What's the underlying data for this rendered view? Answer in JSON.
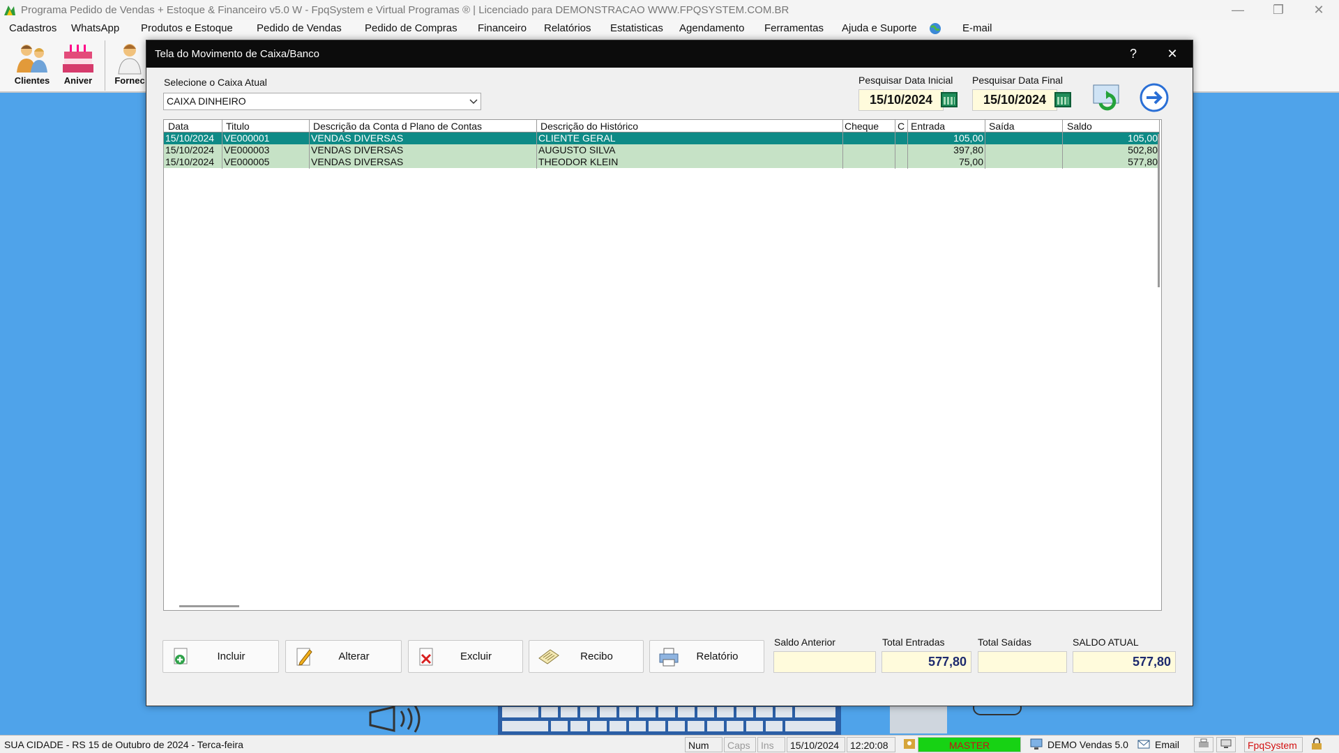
{
  "window": {
    "title": "Programa Pedido de Vendas + Estoque & Financeiro v5.0 W - FpqSystem e Virtual Programas ® | Licenciado para  DEMONSTRACAO WWW.FPQSYSTEM.COM.BR"
  },
  "menu": {
    "items": [
      "Cadastros",
      "WhatsApp",
      "Produtos e Estoque",
      "Pedido de Vendas",
      "Pedido de Compras",
      "Financeiro",
      "Relatórios",
      "Estatisticas",
      "Agendamento",
      "Ferramentas",
      "Ajuda e Suporte",
      "E-mail"
    ]
  },
  "toolbar": {
    "items": [
      "Clientes",
      "Aniver",
      "Fornec"
    ]
  },
  "dialog": {
    "title": "Tela do Movimento de Caixa/Banco",
    "help": "?",
    "close": "✕",
    "caixa_label": "Selecione o Caixa Atual",
    "caixa_value": "CAIXA DINHEIRO",
    "data_inicial_label": "Pesquisar Data Inicial",
    "data_inicial": "15/10/2024",
    "data_final_label": "Pesquisar Data Final",
    "data_final": "15/10/2024"
  },
  "grid": {
    "columns": [
      "Data",
      "Titulo",
      "Descrição da Conta d Plano de Contas",
      "Descrição do Histórico",
      "Cheque",
      "C",
      "Entrada",
      "Saída",
      "Saldo"
    ],
    "rows": [
      {
        "data": "15/10/2024",
        "titulo": "VE000001",
        "conta": "VENDAS DIVERSAS",
        "historico": "CLIENTE GERAL",
        "cheque": "",
        "c": "",
        "entrada": "105,00",
        "saida": "",
        "saldo": "105,00"
      },
      {
        "data": "15/10/2024",
        "titulo": "VE000003",
        "conta": "VENDAS DIVERSAS",
        "historico": "AUGUSTO SILVA",
        "cheque": "",
        "c": "",
        "entrada": "397,80",
        "saida": "",
        "saldo": "502,80"
      },
      {
        "data": "15/10/2024",
        "titulo": "VE000005",
        "conta": "VENDAS DIVERSAS",
        "historico": "THEODOR KLEIN",
        "cheque": "",
        "c": "",
        "entrada": "75,00",
        "saida": "",
        "saldo": "577,80"
      }
    ]
  },
  "actions": {
    "incluir": "Incluir",
    "alterar": "Alterar",
    "excluir": "Excluir",
    "recibo": "Recibo",
    "relatorio": "Relatório"
  },
  "totals": {
    "saldo_anterior_label": "Saldo Anterior",
    "saldo_anterior": "",
    "total_entradas_label": "Total Entradas",
    "total_entradas": "577,80",
    "total_saidas_label": "Total Saídas",
    "total_saidas": "",
    "saldo_atual_label": "SALDO ATUAL",
    "saldo_atual": "577,80"
  },
  "status": {
    "city": "SUA CIDADE - RS 15 de Outubro de 2024 - Terca-feira",
    "num": "Num",
    "caps": "Caps",
    "ins": "Ins",
    "date": "15/10/2024",
    "time": "12:20:08",
    "user": "MASTER",
    "version": "DEMO Vendas 5.0",
    "email": "Email",
    "brand": "FpqSystem"
  },
  "colors": {
    "desktop": "#4fa3ea",
    "selected_row": "#0e8a86",
    "row": "#c6e2c6",
    "value_box": "#fffbdc",
    "master": "#17d214"
  }
}
